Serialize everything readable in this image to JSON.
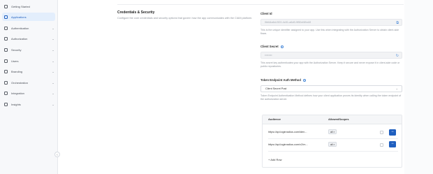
{
  "sidebar": {
    "items": [
      {
        "label": "Getting Started",
        "icon": "home-icon",
        "expandable": false,
        "active": false
      },
      {
        "label": "Applications",
        "icon": "grid-icon",
        "expandable": false,
        "active": true
      },
      {
        "label": "Authentication",
        "icon": "key-icon",
        "expandable": true,
        "active": false
      },
      {
        "label": "Authorization",
        "icon": "lock-icon",
        "expandable": true,
        "active": false
      },
      {
        "label": "Security",
        "icon": "shield-icon",
        "expandable": true,
        "active": false
      },
      {
        "label": "Users",
        "icon": "user-icon",
        "expandable": true,
        "active": false
      },
      {
        "label": "Branding",
        "icon": "brush-icon",
        "expandable": true,
        "active": false
      },
      {
        "label": "Orchestration",
        "icon": "flow-icon",
        "expandable": true,
        "active": false
      },
      {
        "label": "Integration",
        "icon": "plug-icon",
        "expandable": true,
        "active": false
      },
      {
        "label": "Insights",
        "icon": "chart-icon",
        "expandable": true,
        "active": false
      }
    ],
    "collapse_icon": "chevron-left-icon"
  },
  "section": {
    "title": "Credentials & Security",
    "description": "Configure the core credentials and security options that govern how the app communicates with the CIAM platform."
  },
  "client_id": {
    "label": "Client Id",
    "value": "0bfd4a6d-f320-4c51-a6d0-9f50cf4fbd4f",
    "help": "This is the unique identifier assigned to your app. Use this when integrating with the Authorization Server to obtain client-side flows."
  },
  "client_secret": {
    "label": "Client Secret",
    "value": "••••••••",
    "help": "This secret key authenticates your app with the Authorization Server. Keep it secure and never expose it in client-side code or public repositories."
  },
  "token_auth": {
    "label": "Token Endpoint Auth Method",
    "selected": "Client Secret Post",
    "help": "Token Endpoint Authentication Method defines how your client application proves its identity when calling the token endpoint of the authorization server."
  },
  "audience_table": {
    "headers": [
      "Audience",
      "AllowedScopes"
    ],
    "rows": [
      {
        "audience": "https://api.loginradius.com/iden...",
        "scope": "all"
      },
      {
        "audience": "https://api.loginradius.com/v2/m...",
        "scope": "all"
      }
    ],
    "add_row_label": "+ Add Row"
  }
}
